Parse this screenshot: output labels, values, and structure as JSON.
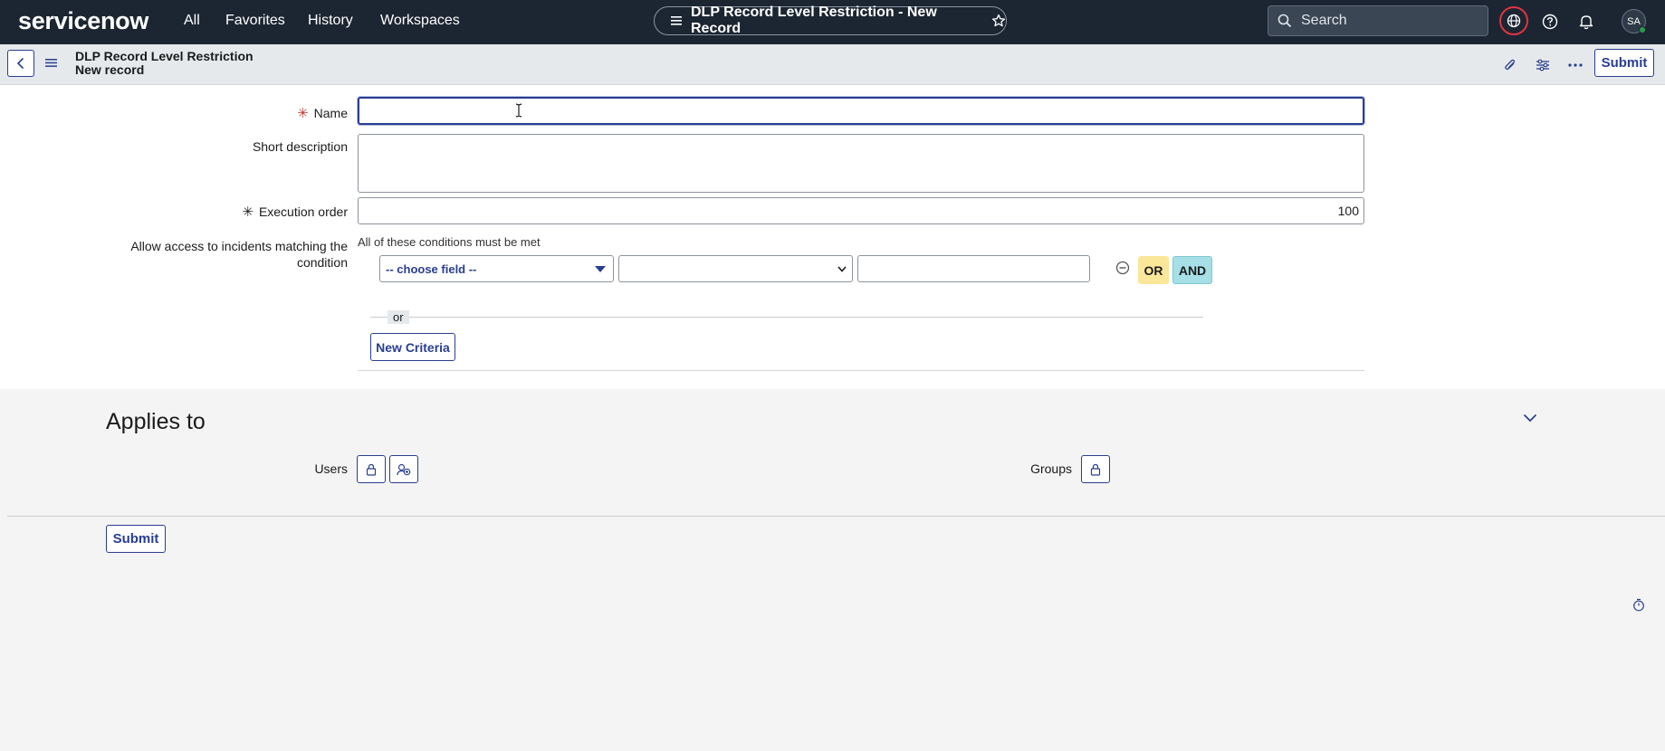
{
  "nav": {
    "logo": "servicenow",
    "links": [
      "All",
      "Favorites",
      "History",
      "Workspaces"
    ],
    "record_title": "DLP Record Level Restriction - New Record",
    "search_placeholder": "Search",
    "avatar_initials": "SA",
    "icons": [
      "list-icon",
      "star-icon",
      "search-icon",
      "globe-icon",
      "help-icon",
      "bell-icon"
    ]
  },
  "form_header": {
    "title": "DLP Record Level Restriction",
    "subtitle": "New record",
    "submit_label": "Submit",
    "icons": [
      "back-icon",
      "hamburger-icon",
      "attachment-icon",
      "settings-sliders-icon",
      "more-icon"
    ]
  },
  "form": {
    "name_label": "Name",
    "name_value": "",
    "short_desc_label": "Short description",
    "short_desc_value": "",
    "exec_order_label": "Execution order",
    "exec_order_value": "100",
    "condition_label": "Allow access to incidents matching the condition",
    "condition_header": "All of these conditions must be met",
    "choose_field": "-- choose field --",
    "or_button": "OR",
    "and_button": "AND",
    "or_separator": "or",
    "new_criteria": "New Criteria"
  },
  "applies_to": {
    "title": "Applies to",
    "users_label": "Users",
    "groups_label": "Groups"
  },
  "footer": {
    "submit_label": "Submit"
  },
  "colors": {
    "nav_bg": "#1c2632",
    "accent": "#293e90",
    "or_bg": "#fbe79a",
    "and_bg": "#a6dfe6",
    "required": "#c13a3a"
  }
}
